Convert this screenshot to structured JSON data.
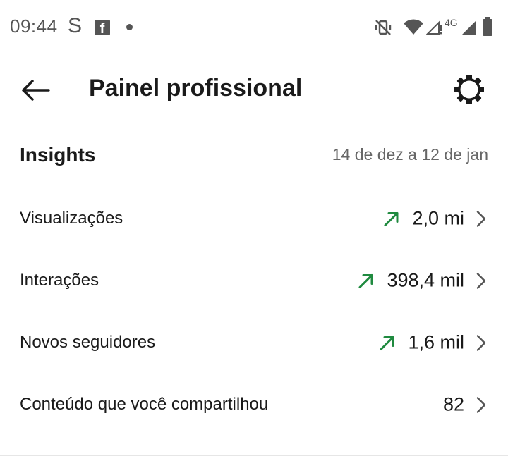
{
  "status_bar": {
    "time": "09:44",
    "app_letter": "S",
    "fb_letter": "f",
    "icons": [
      "mute-vibrate-icon",
      "wifi-icon",
      "signal-alert-icon",
      "4g-label",
      "signal-icon",
      "battery-icon"
    ],
    "network_label": "4G",
    "signal_alert": "!"
  },
  "header": {
    "title": "Painel profissional",
    "back_icon": "arrow-left-icon",
    "settings_icon": "gear-icon"
  },
  "insights": {
    "title": "Insights",
    "date_range": "14 de dez a 12 de jan",
    "rows": [
      {
        "label": "Visualizações",
        "value": "2,0 mi",
        "trend": "up"
      },
      {
        "label": "Interações",
        "value": "398,4 mil",
        "trend": "up"
      },
      {
        "label": "Novos seguidores",
        "value": "1,6 mil",
        "trend": "up"
      },
      {
        "label": "Conteúdo que você compartilhou",
        "value": "82",
        "trend": "none"
      }
    ]
  },
  "colors": {
    "trend_up": "#1f8a3f",
    "text_primary": "#1a1a1a",
    "text_secondary": "#666666",
    "status_icons": "#555555"
  }
}
